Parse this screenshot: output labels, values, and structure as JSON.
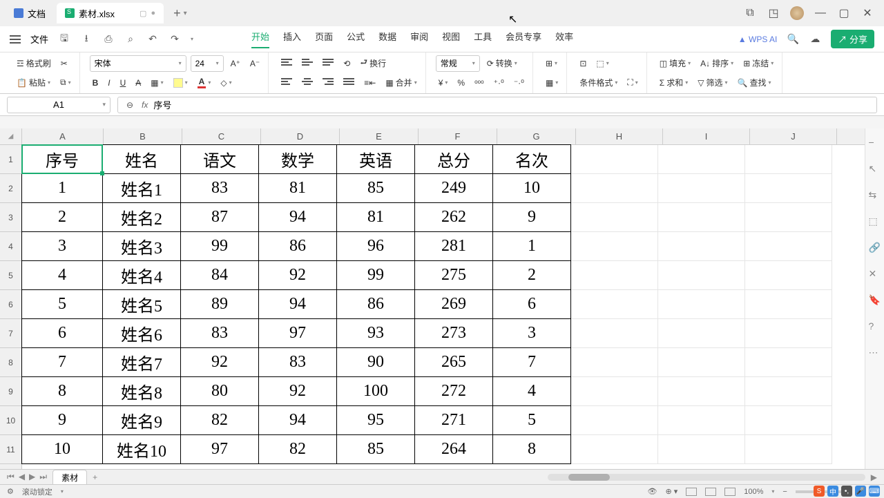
{
  "tabs": {
    "doc": "文档",
    "xls": "素材.xlsx"
  },
  "menu": {
    "file": "文件",
    "items": [
      "开始",
      "插入",
      "页面",
      "公式",
      "数据",
      "审阅",
      "视图",
      "工具",
      "会员专享",
      "效率"
    ],
    "active": 0,
    "wpsai": "WPS AI",
    "share": "分享"
  },
  "ribbon": {
    "format_painter": "格式刷",
    "paste": "粘贴",
    "font_name": "宋体",
    "font_size": "24",
    "wrap": "换行",
    "merge": "合并",
    "number_format": "常规",
    "convert": "转换",
    "cond_fmt": "条件格式",
    "fill": "填充",
    "sort": "排序",
    "freeze": "冻结",
    "sum": "求和",
    "filter": "筛选",
    "find": "查找"
  },
  "namebox": "A1",
  "formula_value": "序号",
  "columns": [
    "A",
    "B",
    "C",
    "D",
    "E",
    "F",
    "G",
    "H",
    "I",
    "J"
  ],
  "row_numbers": [
    "1",
    "2",
    "3",
    "4",
    "5",
    "6",
    "7",
    "8",
    "9",
    "10",
    "11"
  ],
  "headers": [
    "序号",
    "姓名",
    "语文",
    "数学",
    "英语",
    "总分",
    "名次"
  ],
  "rows": [
    [
      "1",
      "姓名1",
      "83",
      "81",
      "85",
      "249",
      "10"
    ],
    [
      "2",
      "姓名2",
      "87",
      "94",
      "81",
      "262",
      "9"
    ],
    [
      "3",
      "姓名3",
      "99",
      "86",
      "96",
      "281",
      "1"
    ],
    [
      "4",
      "姓名4",
      "84",
      "92",
      "99",
      "275",
      "2"
    ],
    [
      "5",
      "姓名5",
      "89",
      "94",
      "86",
      "269",
      "6"
    ],
    [
      "6",
      "姓名6",
      "83",
      "97",
      "93",
      "273",
      "3"
    ],
    [
      "7",
      "姓名7",
      "92",
      "83",
      "90",
      "265",
      "7"
    ],
    [
      "8",
      "姓名8",
      "80",
      "92",
      "100",
      "272",
      "4"
    ],
    [
      "9",
      "姓名9",
      "82",
      "94",
      "95",
      "271",
      "5"
    ],
    [
      "10",
      "姓名10",
      "97",
      "82",
      "85",
      "264",
      "8"
    ]
  ],
  "sheet_name": "素材",
  "status": {
    "scroll_lock": "滚动锁定",
    "zoom": "100%"
  },
  "chart_data": {
    "type": "table",
    "title": "",
    "columns": [
      "序号",
      "姓名",
      "语文",
      "数学",
      "英语",
      "总分",
      "名次"
    ],
    "data": [
      {
        "序号": 1,
        "姓名": "姓名1",
        "语文": 83,
        "数学": 81,
        "英语": 85,
        "总分": 249,
        "名次": 10
      },
      {
        "序号": 2,
        "姓名": "姓名2",
        "语文": 87,
        "数学": 94,
        "英语": 81,
        "总分": 262,
        "名次": 9
      },
      {
        "序号": 3,
        "姓名": "姓名3",
        "语文": 99,
        "数学": 86,
        "英语": 96,
        "总分": 281,
        "名次": 1
      },
      {
        "序号": 4,
        "姓名": "姓名4",
        "语文": 84,
        "数学": 92,
        "英语": 99,
        "总分": 275,
        "名次": 2
      },
      {
        "序号": 5,
        "姓名": "姓名5",
        "语文": 89,
        "数学": 94,
        "英语": 86,
        "总分": 269,
        "名次": 6
      },
      {
        "序号": 6,
        "姓名": "姓名6",
        "语文": 83,
        "数学": 97,
        "英语": 93,
        "总分": 273,
        "名次": 3
      },
      {
        "序号": 7,
        "姓名": "姓名7",
        "语文": 92,
        "数学": 83,
        "英语": 90,
        "总分": 265,
        "名次": 7
      },
      {
        "序号": 8,
        "姓名": "姓名8",
        "语文": 80,
        "数学": 92,
        "英语": 100,
        "总分": 272,
        "名次": 4
      },
      {
        "序号": 9,
        "姓名": "姓名9",
        "语文": 82,
        "数学": 94,
        "英语": 95,
        "总分": 271,
        "名次": 5
      },
      {
        "序号": 10,
        "姓名": "姓名10",
        "语文": 97,
        "数学": 82,
        "英语": 85,
        "总分": 264,
        "名次": 8
      }
    ]
  }
}
